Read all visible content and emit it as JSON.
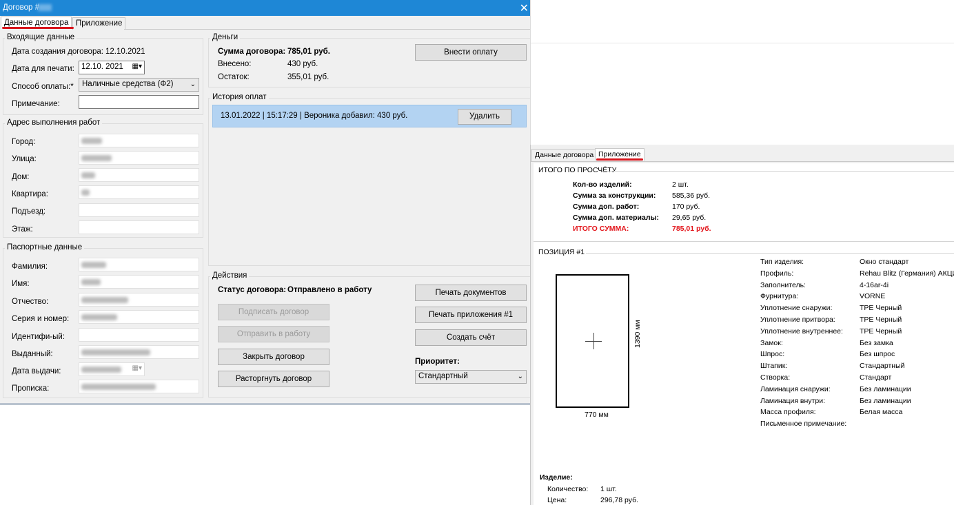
{
  "window": {
    "title": "Договор #",
    "close_glyph": "✕"
  },
  "tabs": {
    "contract_data": "Данные договора",
    "appendix": "Приложение"
  },
  "incoming": {
    "title": "Входящие данные",
    "created_label": "Дата создания договора:",
    "created_value": "12.10.2021",
    "print_date_label": "Дата для печати:",
    "print_date_value": "12.10. 2021",
    "payment_label": "Способ оплаты:*",
    "payment_value": "Наличные средства (Ф2)",
    "note_label": "Примечание:",
    "note_value": ""
  },
  "address": {
    "title": "Адрес выполнения работ",
    "city_label": "Город:",
    "street_label": "Улица:",
    "house_label": "Дом:",
    "apartment_label": "Квартира:",
    "entrance_label": "Подъезд:",
    "floor_label": "Этаж:"
  },
  "passport": {
    "title": "Паспортные данные",
    "surname_label": "Фамилия:",
    "name_label": "Имя:",
    "patronymic_label": "Отчество:",
    "series_label": "Серия и номер:",
    "ident_label": "Идентифи-ый:",
    "issued_label": "Выданный:",
    "issue_date_label": "Дата выдачи:",
    "registration_label": "Прописка:"
  },
  "money": {
    "title": "Деньги",
    "sum_label": "Сумма договора:",
    "sum_value": "785,01 руб.",
    "paid_label": "Внесено:",
    "paid_value": "430 руб.",
    "rest_label": "Остаток:",
    "rest_value": "355,01 руб.",
    "pay_button": "Внести оплату"
  },
  "history": {
    "title": "История оплат",
    "entry": "13.01.2022 | 15:17:29 | Вероника добавил: 430 руб.",
    "delete_button": "Удалить"
  },
  "actions": {
    "title": "Действия",
    "status_label": "Статус договора:",
    "status_value": "Отправлено в работу",
    "sign_button": "Подписать договор",
    "send_button": "Отправить в работу",
    "close_button": "Закрыть договор",
    "terminate_button": "Расторгнуть договор",
    "print_docs_button": "Печать документов",
    "print_appendix_button": "Печать приложения #1",
    "invoice_button": "Создать счёт",
    "priority_label": "Приоритет:",
    "priority_value": "Стандартный"
  },
  "summary": {
    "title": "ИТОГО ПО ПРОСЧЁТУ",
    "rows": [
      {
        "label": "Кол-во изделий:",
        "value": "2 шт."
      },
      {
        "label": "Сумма за конструкции:",
        "value": "585,36 руб."
      },
      {
        "label": "Сумма доп. работ:",
        "value": "170 руб."
      },
      {
        "label": "Сумма доп. материалы:",
        "value": "29,65 руб."
      }
    ],
    "total_label": "ИТОГО СУММА:",
    "total_value": "785,01 руб."
  },
  "position": {
    "title": "ПОЗИЦИЯ #1",
    "width_label": "770 мм",
    "height_label": "1390 мм",
    "specs": [
      {
        "label": "Тип изделия:",
        "value": "Окно стандарт"
      },
      {
        "label": "Профиль:",
        "value": "Rehau Blitz (Германия) АКЦИ"
      },
      {
        "label": "Заполнитель:",
        "value": "4-16ar-4i"
      },
      {
        "label": "Фурнитура:",
        "value": "VORNE"
      },
      {
        "label": "Уплотнение снаружи:",
        "value": "TPE Черный"
      },
      {
        "label": "Уплотнение притвора:",
        "value": "TPE Черный"
      },
      {
        "label": "Уплотнение внутреннее:",
        "value": "TPE Черный"
      },
      {
        "label": "Замок:",
        "value": "Без замка"
      },
      {
        "label": "Шпрос:",
        "value": "Без шпрос"
      },
      {
        "label": "Штапик:",
        "value": "Стандартный"
      },
      {
        "label": "Створка:",
        "value": "Стандарт"
      },
      {
        "label": "Ламинация снаружи:",
        "value": "Без ламинации"
      },
      {
        "label": "Ламинация внутри:",
        "value": "Без ламинации"
      },
      {
        "label": "Масса профиля:",
        "value": "Белая масса"
      },
      {
        "label": "Письменное примечание:",
        "value": ""
      }
    ],
    "product_title": "Изделие:",
    "quantity_label": "Количество:",
    "quantity_value": "1 шт.",
    "price_label": "Цена:",
    "price_value": "296,78 руб."
  },
  "colors": {
    "titlebar": "#1e87d6",
    "accent_red": "#d8141b",
    "selected_row": "#b3d3f2"
  }
}
